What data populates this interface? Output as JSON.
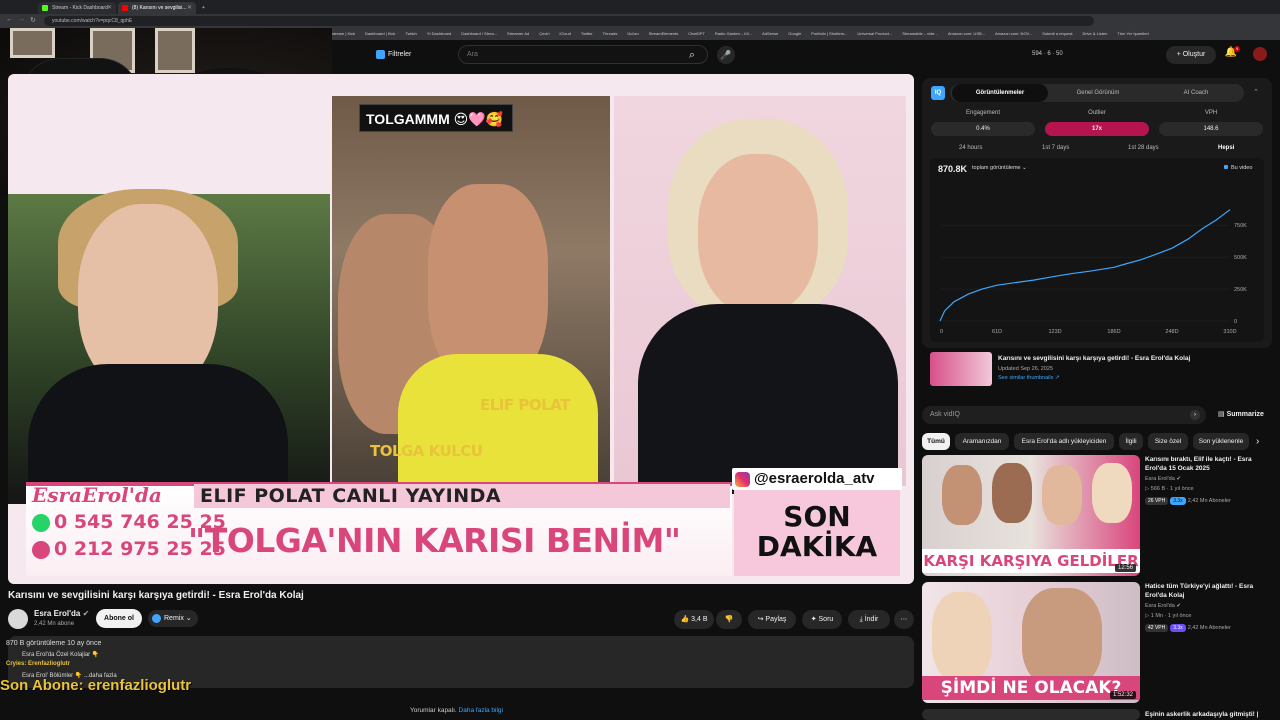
{
  "browser": {
    "tabs": [
      {
        "label": "Stream - Kick Dashboard",
        "color": "#53fc18"
      },
      {
        "label": "(8) Karısını ve sevgilisi...",
        "color": "#ff0000"
      }
    ],
    "new_tab": "+",
    "url": "youtube.com/watch?v=pqcC8_qphE",
    "bookmarks": [
      "stream | Kick",
      "Dashboard | Kick",
      "Twitch",
      "Yt Dashboard",
      "Dashboard / Strea...",
      "Streamer Ad",
      "Çeviri",
      "iCloud",
      "Twitter",
      "Threads",
      "Ücüzu",
      "StreamElements",
      "ChatGPT",
      "Radio Garden – Kli...",
      "AdSense",
      "Google",
      "Portfolio | Shotters...",
      "Universal Product...",
      "Streamable – vide...",
      "Amazon.com: USB...",
      "Amazon.com: NOV...",
      "Submit a request",
      "Drive & Listen",
      "Tüm Yer İşaretleri"
    ]
  },
  "header": {
    "filters": "Filtreler",
    "search_placeholder": "Ara",
    "stats": "594 · 6 · 50",
    "create": "Oluştur",
    "notifications": "9"
  },
  "video": {
    "overlay_tag": "TOLGAMMM 😍🩷🥰",
    "label_elif": "ELIF POLAT",
    "label_tolga": "TOLGA KULCU",
    "instagram": "@esraerolda_atv",
    "brand": "EsraErol'da",
    "live_banner": "ELIF POLAT CANLI YAYINDA",
    "phone1": "0 545 746 25 25",
    "phone2": "0 212 975 25 25",
    "headline": "\"TOLGA'NIN KARISI BENİM\"",
    "son_line1": "SON",
    "son_line2": "DAKİKA"
  },
  "meta": {
    "title": "Karısını ve sevgilisini karşı karşıya getirdi! - Esra Erol'da Kolaj",
    "channel": "Esra Erol'da",
    "subs": "2,42 Mn abone",
    "subscribe": "Abone ol",
    "remix": "Remix",
    "likes": "3,4 B",
    "share": "Paylaş",
    "ask": "Soru",
    "download": "İndir",
    "more": "⋯"
  },
  "description": {
    "views_line": "870 B görüntüleme  10 ay önce",
    "line2": "Esra Erol'da Özel Kolajlar 👇",
    "line3": "Cryies: Erenfazlioglutr",
    "line4": "Esra Erol' Bölümler 👇 ...daha fazla"
  },
  "stream_overlay": {
    "last_sub": "Son Abone: erenfazlioglutr"
  },
  "comments_note": {
    "text": "Yorumlar kapalı.",
    "link": "Daha fazla bilgi"
  },
  "vidiq": {
    "logo": "IQ",
    "tabs": [
      "Görüntülenmeler",
      "Genel Görünüm",
      "AI Coach"
    ],
    "metrics": [
      {
        "label": "Engagement",
        "value": "0.4%"
      },
      {
        "label": "Outlier",
        "value": "17x"
      },
      {
        "label": "VPH",
        "value": "148.6"
      }
    ],
    "ranges": [
      "24 hours",
      "1st 7 days",
      "1st 28 days",
      "Hepsi"
    ],
    "total_views": "870.8K",
    "view_select": "toplam görüntüleme ⌄",
    "legend": "Bu video",
    "related_title": "Karısını ve sevgilisini karşı karşıya getirdi! - Esra Erol'da Kolaj",
    "related_updated": "Updated Sep 26, 2025",
    "related_similar": "See similar thumbnails ↗",
    "ask_placeholder": "Ask vidIQ",
    "summarize": "Summarize"
  },
  "chart_data": {
    "type": "line",
    "x_ticks": [
      "0",
      "61D",
      "123D",
      "186D",
      "248D",
      "310D"
    ],
    "y_ticks": [
      "0",
      "250K",
      "500K",
      "750K"
    ],
    "ylim": [
      0,
      900000
    ],
    "xlim": [
      0,
      310
    ],
    "series": [
      {
        "name": "Bu video",
        "x": [
          0,
          5,
          15,
          30,
          45,
          61,
          80,
          100,
          123,
          140,
          160,
          186,
          200,
          215,
          230,
          248,
          265,
          280,
          295,
          310
        ],
        "y": [
          0,
          80000,
          150000,
          210000,
          250000,
          280000,
          300000,
          320000,
          350000,
          370000,
          390000,
          420000,
          450000,
          480000,
          520000,
          570000,
          640000,
          720000,
          790000,
          870800
        ]
      }
    ]
  },
  "chips": [
    "Tümü",
    "Aramanızdan",
    "Esra Erol'da adlı yükleyiciden",
    "İlgili",
    "Size özel",
    "Son yüklenenle"
  ],
  "recommendations": [
    {
      "title": "Karısını bıraktı, Elif ile kaçtı! - Esra Erol'da 15 Ocak 2025",
      "channel": "Esra Erol'da",
      "views": "▷ 566 B · 1 yıl önce",
      "vph": "26 VPH",
      "mult": "3.3x",
      "subs": "2,42 Mn Aboneler",
      "duration": "12:56",
      "banner": "KARŞI KARŞIYA GELDİLER"
    },
    {
      "title": "Hatice tüm Türkiye'yi ağlattı! - Esra Erol'da Kolaj",
      "channel": "Esra Erol'da",
      "views": "▷ 1 Mn · 1 yıl önce",
      "vph": "42 VPH",
      "mult": "3.3x",
      "subs": "2,42 Mn Aboneler",
      "duration": "1:52:32",
      "banner": "ŞİMDİ NE OLACAK?"
    },
    {
      "title": "Eşinin askerlik arkadaşıyla gitmişti! |"
    }
  ]
}
